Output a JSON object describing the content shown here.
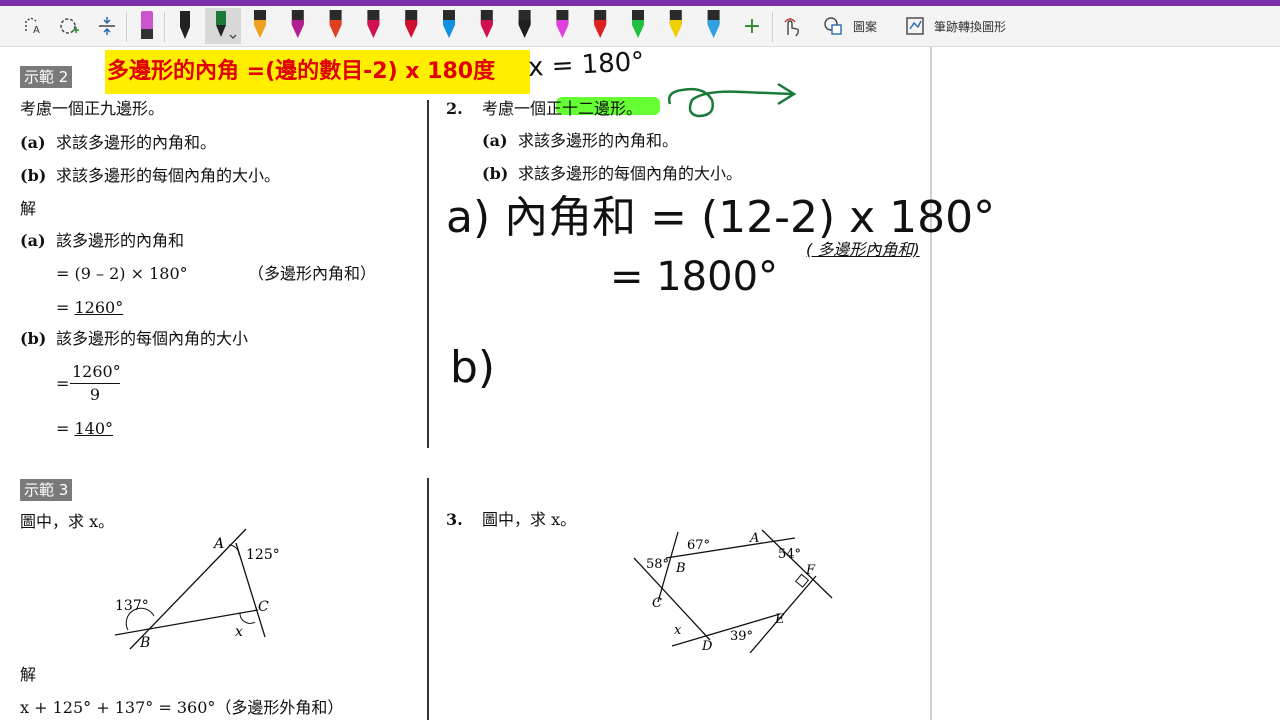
{
  "toolbar": {
    "accent": "#7b2fa8",
    "tools": [
      "lasso-select-icon",
      "add-space-icon",
      "insert-space-icon",
      "highlighter-purple-icon",
      "pen-black-icon",
      "pen-dark-green-icon"
    ],
    "pen_colors": [
      "#f0a020",
      "#b02090",
      "#e04020",
      "#d01050",
      "#d01030",
      "#1090e0",
      "#d01050",
      "#202020",
      "#e040e0",
      "#e02020",
      "#20c040",
      "#f0d000",
      "#30a0e0"
    ],
    "add_pen": "+",
    "touch_draw": "",
    "shapes_label": "圖案",
    "ink_to_shape_label": "筆跡轉換圖形"
  },
  "left": {
    "ex2_label": "示範 2",
    "ex2_question": "考慮一個正九邊形。",
    "ex2_a_mark": "(a)",
    "ex2_a_text": "求該多邊形的內角和。",
    "ex2_b_mark": "(b)",
    "ex2_b_text": "求該多邊形的每個內角的大小。",
    "solution": "解",
    "sol_a_mark": "(a)",
    "sol_a_text": "該多邊形的內角和",
    "sol_a_line1": "= (9 – 2) × 180°",
    "sol_a_reason": "（多邊形內角和）",
    "sol_a_eq": "= ",
    "sol_a_answer": "1260°",
    "sol_b_mark": "(b)",
    "sol_b_text": "該多邊形的每個內角的大小",
    "sol_b_eq1": "=",
    "sol_b_num": "1260°",
    "sol_b_den": "9",
    "sol_b_eq2": "= ",
    "sol_b_answer": "140°",
    "ex3_label": "示範 3",
    "ex3_question": "圖中，求 x。",
    "ex3_sol": "解",
    "ex3_sol_line": "x + 125° + 137° = 360°（多邊形外角和）",
    "fig": {
      "A": "A",
      "B": "B",
      "C": "C",
      "a125": "125°",
      "a137": "137°",
      "x": "x"
    }
  },
  "banner": "多邊形的內角 =(邊的數目-2) x 180度",
  "right": {
    "q2_num": "2.",
    "q2_text": "考慮一個正十二邊形。",
    "q2_a_mark": "(a)",
    "q2_a_text": "求該多邊形的內角和。",
    "q2_b_mark": "(b)",
    "q2_b_text": "求該多邊形的每個內角的大小。",
    "hw_top": "x = 180°",
    "hw_a_line1": "a) 內角和 = (12-2) x 180°",
    "hw_reason": "( 多邊形內角和)",
    "hw_a_line2": "= 1800°",
    "hw_b": "b)",
    "q3_num": "3.",
    "q3_text": "圖中，求 x。",
    "fig": {
      "A": "A",
      "B": "B",
      "C": "C",
      "D": "D",
      "E": "E",
      "F": "F",
      "a67": "67°",
      "a54": "54°",
      "a58": "58°",
      "a39": "39°",
      "x": "x"
    }
  }
}
